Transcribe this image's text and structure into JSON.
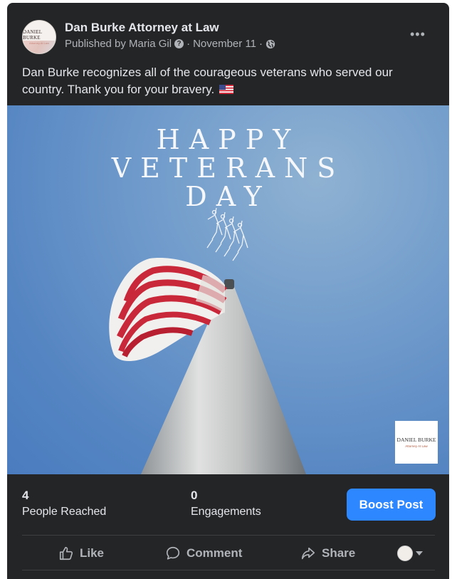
{
  "post": {
    "page_name": "Dan Burke Attorney at Law",
    "published_by": "Published by Maria Gil",
    "date": "November 11",
    "separator": "·",
    "avatar_logo_text": "DANIEL BURKE",
    "avatar_logo_sub": "Attorney At Law",
    "more_icon": "more-horizontal-icon",
    "text": "Dan Burke recognizes all of the courageous veterans who served our country. Thank you for your bravery.",
    "emoji": "us-flag-emoji"
  },
  "image": {
    "headline_line1": "HAPPY",
    "headline_line2": "VETERANS",
    "headline_line3": "DAY",
    "brand_name": "DANIEL BURKE",
    "brand_sub": "Attorney At Law",
    "sky_color": "#5d8cc6"
  },
  "stats": {
    "reached_count": "4",
    "reached_label": "People Reached",
    "engagements_count": "0",
    "engagements_label": "Engagements",
    "boost_label": "Boost Post",
    "boost_color": "#2d88ff"
  },
  "actions": {
    "like": "Like",
    "comment": "Comment",
    "share": "Share"
  }
}
